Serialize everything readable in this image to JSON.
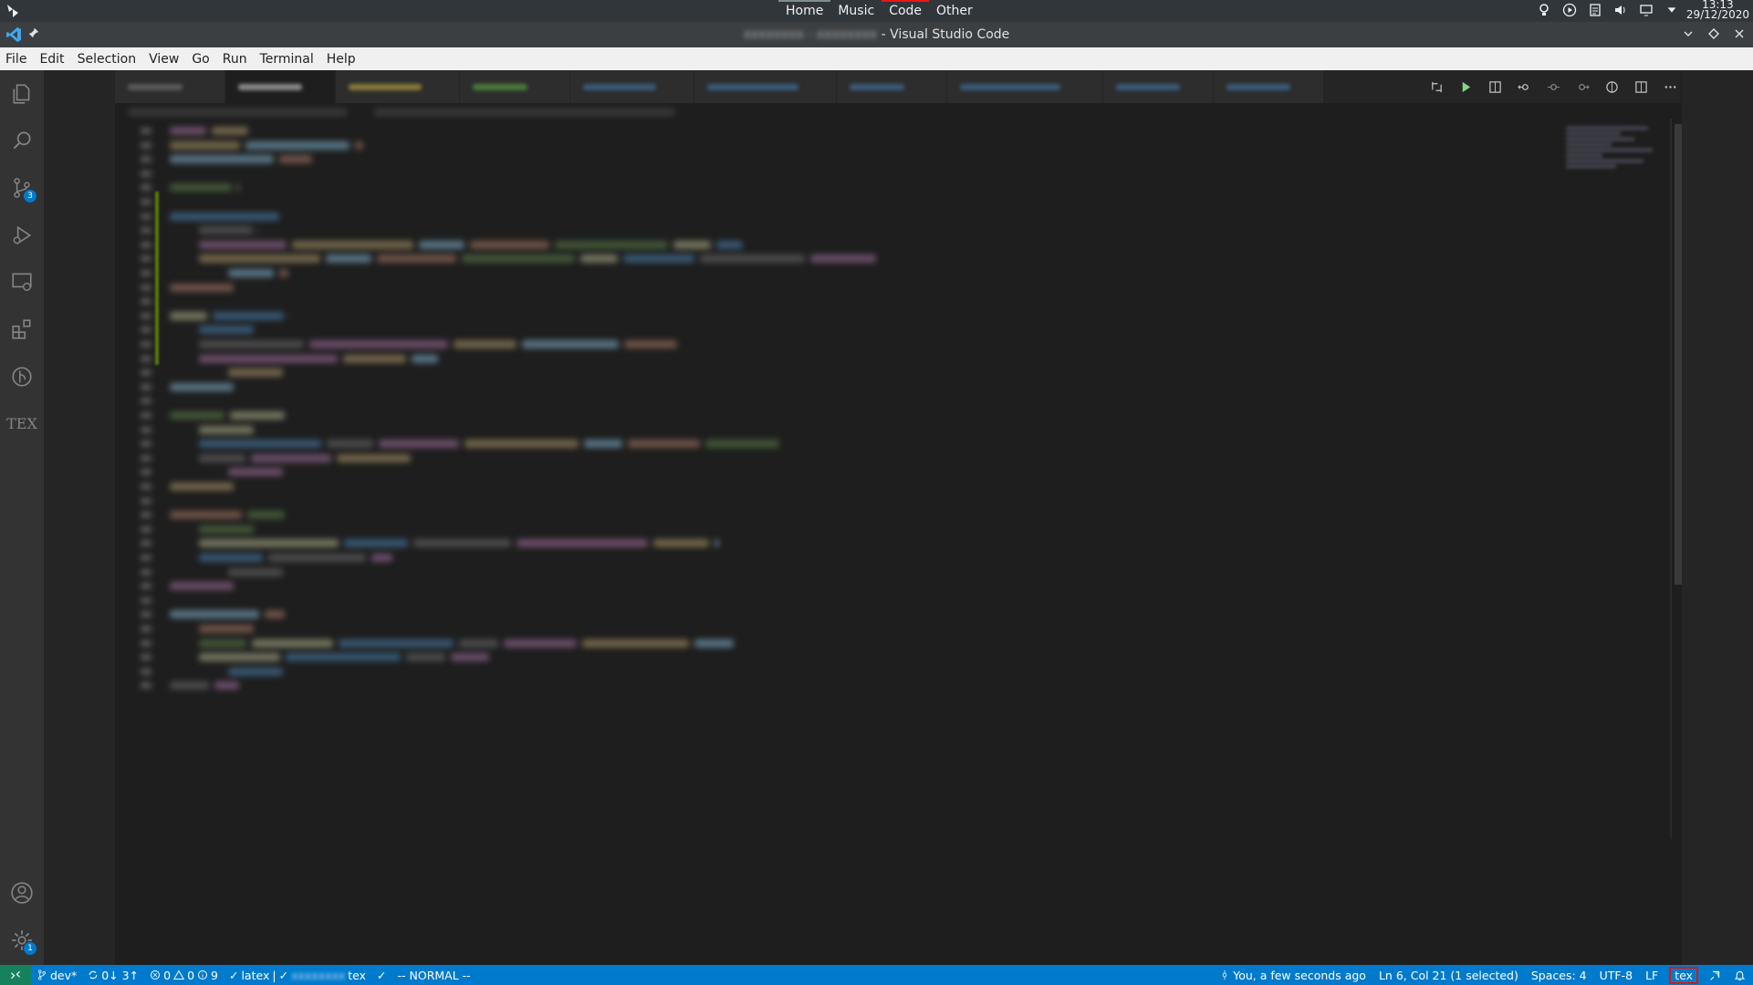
{
  "system_panel": {
    "tabs": [
      "Home",
      "Music",
      "Code",
      "Other"
    ],
    "active_tab": "Code",
    "clock_time": "13:13",
    "clock_date": "29/12/2020"
  },
  "window": {
    "title_suffix": " - Visual Studio Code"
  },
  "menu": {
    "items": [
      "File",
      "Edit",
      "Selection",
      "View",
      "Go",
      "Run",
      "Terminal",
      "Help"
    ]
  },
  "activity_bar": {
    "scm_badge": "3",
    "settings_badge": "1",
    "tex_label": "TEX"
  },
  "status_bar": {
    "branch": "dev*",
    "sync": "0↓ 3↑",
    "errors": "0",
    "warnings": "0",
    "info": "9",
    "latex": "latex",
    "separator": "|",
    "tex_file": "tex",
    "mode": "-- NORMAL --",
    "blame": "You, a few seconds ago",
    "cursor": "Ln 6, Col 21 (1 selected)",
    "spaces": "Spaces: 4",
    "encoding": "UTF-8",
    "eol": "LF",
    "language": "tex"
  },
  "colors": {
    "status_bg": "#007acc",
    "remote_bg": "#16825d",
    "highlight": "#e51400"
  }
}
